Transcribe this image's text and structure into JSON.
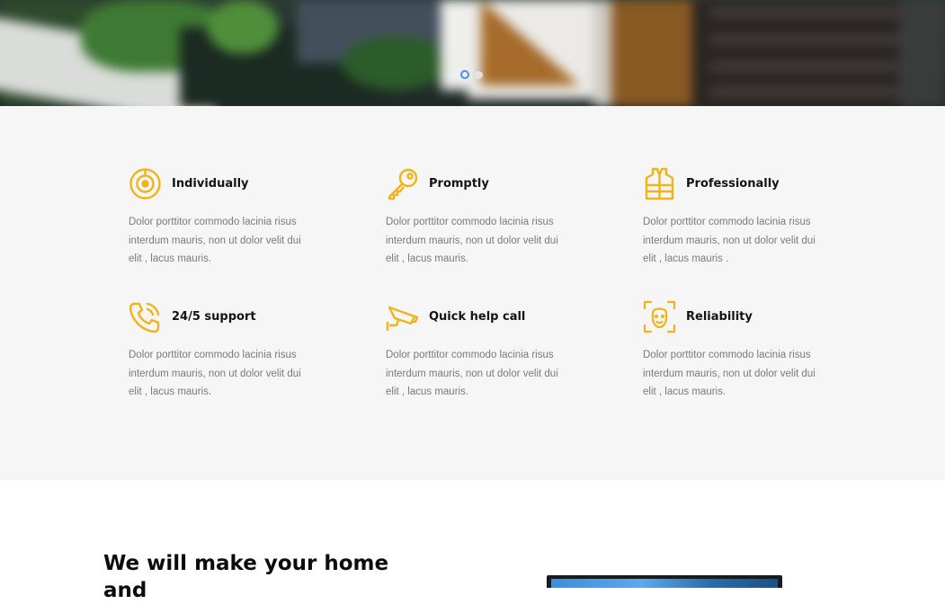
{
  "hero": {
    "slides": [
      {
        "active": true
      },
      {
        "active": false
      }
    ]
  },
  "features": {
    "accent_color": "#f0b419",
    "items": [
      {
        "icon": "target-icon",
        "title": "Individually",
        "description": "Dolor porttitor commodo lacinia risus interdum mauris, non ut dolor velit dui elit , lacus mauris."
      },
      {
        "icon": "key-icon",
        "title": "Promptly",
        "description": "Dolor porttitor commodo lacinia risus interdum mauris, non ut dolor velit dui elit , lacus mauris."
      },
      {
        "icon": "vest-icon",
        "title": "Professionally",
        "description": "Dolor porttitor commodo lacinia risus interdum mauris, non ut dolor velit dui elit , lacus mauris ."
      },
      {
        "icon": "phone-icon",
        "title": "24/5 support",
        "description": "Dolor porttitor commodo lacinia risus interdum mauris, non ut dolor velit dui elit , lacus mauris."
      },
      {
        "icon": "security-camera-icon",
        "title": "Quick help call",
        "description": "Dolor porttitor commodo lacinia risus interdum mauris, non ut dolor velit dui elit , lacus mauris."
      },
      {
        "icon": "face-scan-icon",
        "title": "Reliability",
        "description": "Dolor porttitor commodo lacinia risus interdum mauris, non ut dolor velit dui elit , lacus mauris."
      }
    ]
  },
  "bottom": {
    "heading": "We will make your home and"
  }
}
